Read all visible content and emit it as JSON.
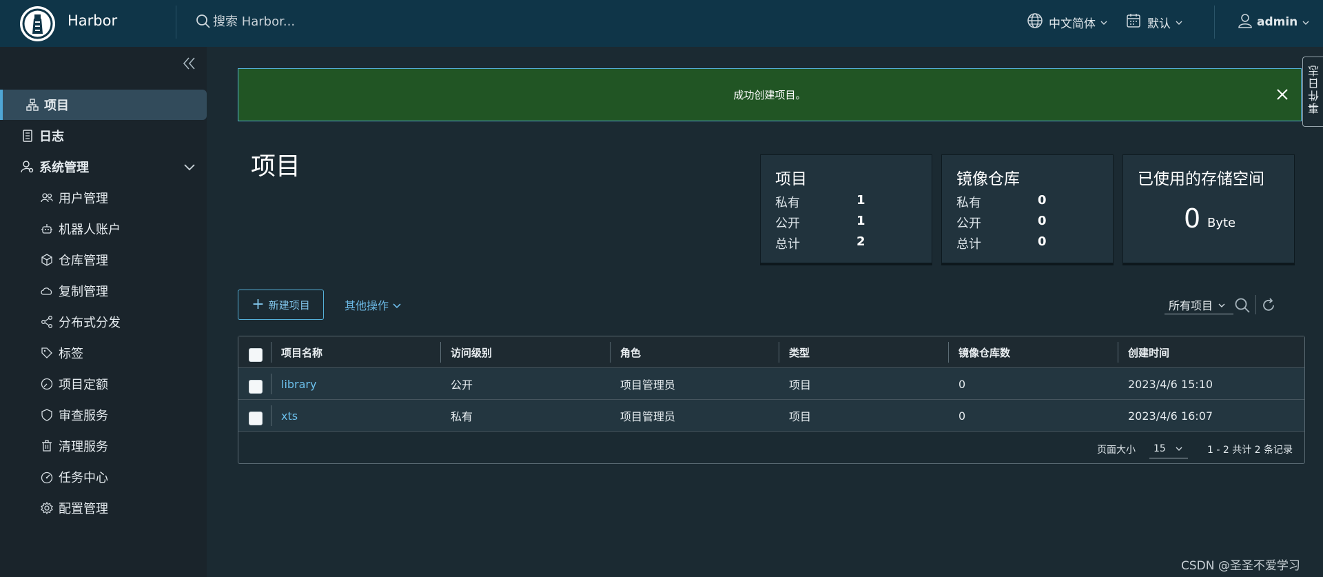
{
  "header": {
    "brand": "Harbor",
    "search_placeholder": "搜索 Harbor...",
    "language": "中文简体",
    "theme": "默认",
    "user": "admin"
  },
  "sidebar": {
    "items": [
      {
        "label": "项目",
        "icon": "project-icon",
        "active": true
      },
      {
        "label": "日志",
        "icon": "log-icon"
      },
      {
        "label": "系统管理",
        "icon": "admin-settings-icon",
        "expanded": true
      },
      {
        "label": "用户管理",
        "icon": "users-icon"
      },
      {
        "label": "机器人账户",
        "icon": "robot-icon"
      },
      {
        "label": "仓库管理",
        "icon": "box-icon"
      },
      {
        "label": "复制管理",
        "icon": "cloud-icon"
      },
      {
        "label": "分布式分发",
        "icon": "share-icon"
      },
      {
        "label": "标签",
        "icon": "tag-icon"
      },
      {
        "label": "项目定额",
        "icon": "quota-icon"
      },
      {
        "label": "审查服务",
        "icon": "shield-icon"
      },
      {
        "label": "清理服务",
        "icon": "trash-icon"
      },
      {
        "label": "任务中心",
        "icon": "dashboard-icon"
      },
      {
        "label": "配置管理",
        "icon": "gear-icon"
      }
    ]
  },
  "alert": {
    "message": "成功创建项目。"
  },
  "page": {
    "title": "项目"
  },
  "cards": {
    "projects": {
      "title": "项目",
      "private_label": "私有",
      "private": "1",
      "public_label": "公开",
      "public": "1",
      "total_label": "总计",
      "total": "2"
    },
    "repos": {
      "title": "镜像仓库",
      "private_label": "私有",
      "private": "0",
      "public_label": "公开",
      "public": "0",
      "total_label": "总计",
      "total": "0"
    },
    "storage": {
      "title": "已使用的存储空间",
      "value": "0",
      "unit": "Byte"
    }
  },
  "toolbar": {
    "new_project": "新建项目",
    "more_actions": "其他操作",
    "filter": "所有项目"
  },
  "table": {
    "columns": [
      "项目名称",
      "访问级别",
      "角色",
      "类型",
      "镜像仓库数",
      "创建时间"
    ],
    "rows": [
      {
        "name": "library",
        "access": "公开",
        "role": "项目管理员",
        "type": "项目",
        "repos": "0",
        "created": "2023/4/6 15:10"
      },
      {
        "name": "xts",
        "access": "私有",
        "role": "项目管理员",
        "type": "项目",
        "repos": "0",
        "created": "2023/4/6 16:07"
      }
    ],
    "page_size_label": "页面大小",
    "page_size": "15",
    "page_info": "1 - 2 共计 2 条记录"
  },
  "side_tab": "事件日志",
  "watermark": "CSDN @圣圣不爱学习"
}
